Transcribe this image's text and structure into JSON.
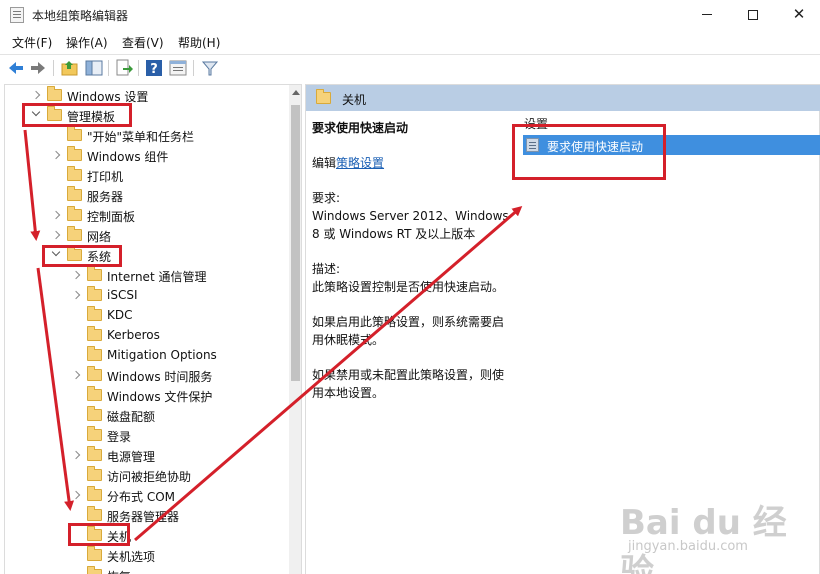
{
  "window": {
    "title": "本地组策略编辑器",
    "controls": [
      "minimize",
      "maximize",
      "close"
    ],
    "close_glyph": "✕"
  },
  "menu": [
    {
      "label": "文件(F)"
    },
    {
      "label": "操作(A)"
    },
    {
      "label": "查看(V)"
    },
    {
      "label": "帮助(H)"
    }
  ],
  "toolbar": {
    "icons": [
      "back-arrow-icon",
      "forward-arrow-icon",
      "folder-up-icon",
      "show-hide-tree-icon",
      "export-list-icon",
      "help-icon",
      "properties-icon",
      "filter-icon"
    ]
  },
  "tree": {
    "items": [
      {
        "label": "Windows 设置",
        "expander": "collapsed"
      },
      {
        "label": "管理模板",
        "expander": "expanded"
      },
      {
        "label": "\"开始\"菜单和任务栏",
        "expander": "none"
      },
      {
        "label": "Windows 组件",
        "expander": "collapsed"
      },
      {
        "label": "打印机",
        "expander": "none"
      },
      {
        "label": "服务器",
        "expander": "none"
      },
      {
        "label": "控制面板",
        "expander": "collapsed"
      },
      {
        "label": "网络",
        "expander": "collapsed"
      },
      {
        "label": "系统",
        "expander": "expanded"
      },
      {
        "label": "Internet 通信管理",
        "expander": "collapsed"
      },
      {
        "label": "iSCSI",
        "expander": "collapsed"
      },
      {
        "label": "KDC",
        "expander": "none"
      },
      {
        "label": "Kerberos",
        "expander": "none"
      },
      {
        "label": "Mitigation Options",
        "expander": "none"
      },
      {
        "label": "Windows 时间服务",
        "expander": "collapsed"
      },
      {
        "label": "Windows 文件保护",
        "expander": "none"
      },
      {
        "label": "磁盘配额",
        "expander": "none"
      },
      {
        "label": "登录",
        "expander": "none"
      },
      {
        "label": "电源管理",
        "expander": "collapsed"
      },
      {
        "label": "访问被拒绝协助",
        "expander": "none"
      },
      {
        "label": "分布式 COM",
        "expander": "collapsed"
      },
      {
        "label": "服务器管理器",
        "expander": "none"
      },
      {
        "label": "关机",
        "expander": "none"
      },
      {
        "label": "关机选项",
        "expander": "none"
      },
      {
        "label": "恢复",
        "expander": "none"
      }
    ]
  },
  "right_pane": {
    "header": "关机",
    "description": {
      "title": "要求使用快速启动",
      "edit_prefix": "编辑",
      "edit_link": "策略设置",
      "requirements_label": "要求:",
      "requirements_line1": "Windows Server 2012、Windows",
      "requirements_line2": "8 或 Windows RT 及以上版本",
      "description_label": "描述:",
      "description_text": "此策略设置控制是否使用快速启动。",
      "enabled_line1": "如果启用此策略设置，则系统需要启",
      "enabled_line2": "用休眠模式。",
      "disabled_line1": "如果禁用或未配置此策略设置，则使",
      "disabled_line2": "用本地设置。"
    },
    "column_header": "设置",
    "selected_setting": "要求使用快速启动"
  },
  "annotation": {
    "color": "#d4202a"
  },
  "watermark": {
    "main": "Bai du 经验",
    "sub": "jingyan.baidu.com"
  }
}
